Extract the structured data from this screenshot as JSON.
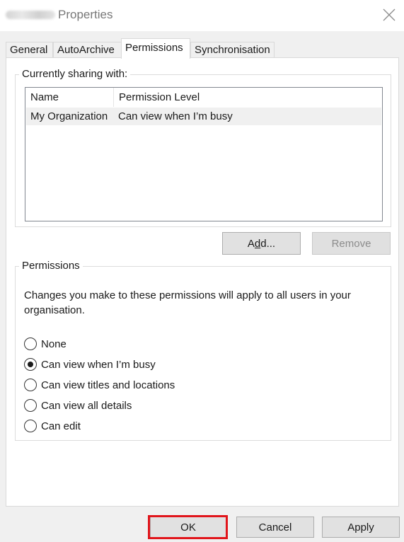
{
  "window": {
    "title": "Properties",
    "close_icon": "close-icon"
  },
  "tabs": [
    {
      "label": "General",
      "active": false
    },
    {
      "label": "AutoArchive",
      "active": false
    },
    {
      "label": "Permissions",
      "active": true
    },
    {
      "label": "Synchronisation",
      "active": false
    }
  ],
  "sharing": {
    "group_label": "Currently sharing with:",
    "columns": [
      "Name",
      "Permission Level"
    ],
    "rows": [
      {
        "name": "My Organization",
        "level": "Can view when I’m busy"
      }
    ],
    "add_prefix": "A",
    "add_underlined": "d",
    "add_suffix": "d...",
    "remove_label": "Remove"
  },
  "permissions": {
    "group_label": "Permissions",
    "note": "Changes you make to these permissions will apply to all users in your organisation.",
    "options": [
      {
        "label": "None",
        "checked": false
      },
      {
        "label": "Can view when I’m busy",
        "checked": true
      },
      {
        "label": "Can view titles and locations",
        "checked": false
      },
      {
        "label": "Can view all details",
        "checked": false
      },
      {
        "label": "Can edit",
        "checked": false
      }
    ]
  },
  "footer": {
    "ok_label": "OK",
    "cancel_label": "Cancel",
    "apply_label": "Apply",
    "highlight_color": "#e1151b"
  }
}
